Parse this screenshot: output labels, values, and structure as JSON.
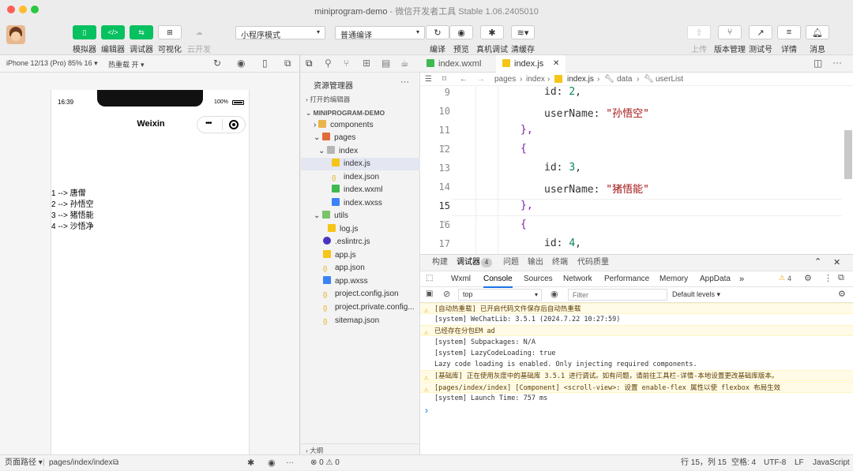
{
  "window": {
    "title": "miniprogram-demo",
    "subtitle": " - 微信开发者工具 Stable 1.06.2405010",
    "traffic_colors": [
      "#ff5f57",
      "#febc2e",
      "#28c840"
    ]
  },
  "toolbar": {
    "left_buttons": [
      {
        "label": "模拟器",
        "icon": "phone-icon"
      },
      {
        "label": "编辑器",
        "icon": "code-icon"
      },
      {
        "label": "调试器",
        "icon": "debug-icon"
      },
      {
        "label": "可视化",
        "icon": "layout-icon"
      },
      {
        "label": "云开发",
        "icon": "cloud-icon"
      }
    ],
    "mode_select": "小程序模式",
    "compile_select": "普通编译",
    "mid_buttons": [
      {
        "label": "编译",
        "icon": "refresh-icon"
      },
      {
        "label": "预览",
        "icon": "eye-icon"
      },
      {
        "label": "真机调试",
        "icon": "bug-icon"
      },
      {
        "label": "清缓存",
        "icon": "layers-icon"
      }
    ],
    "right_buttons": [
      {
        "label": "上传",
        "icon": "upload-icon"
      },
      {
        "label": "版本管理",
        "icon": "branch-icon"
      },
      {
        "label": "测试号",
        "icon": "external-link-icon"
      },
      {
        "label": "详情",
        "icon": "menu-icon"
      },
      {
        "label": "消息",
        "icon": "bell-icon"
      }
    ]
  },
  "simulator": {
    "device": "iPhone 12/13 (Pro) 85% 16 ▾",
    "hot_reload": "热重载 开 ▾",
    "time": "16:39",
    "battery": "100%",
    "nav_title": "Weixin",
    "capsule_dots": "•••",
    "list": [
      "1 --> 唐僧",
      "2 --> 孙悟空",
      "3 --> 猪悟能",
      "4 --> 沙悟净"
    ]
  },
  "explorer": {
    "title": "资源管理器",
    "more": "···",
    "open_editors": "打开的编辑器",
    "project": "MINIPROGRAM-DEMO",
    "outline": "大纲",
    "items": [
      {
        "name": "components",
        "type": "folder"
      },
      {
        "name": "pages",
        "type": "folder"
      },
      {
        "name": "index",
        "type": "folder"
      },
      {
        "name": "index.js",
        "type": "js"
      },
      {
        "name": "index.json",
        "type": "json"
      },
      {
        "name": "index.wxml",
        "type": "wxml"
      },
      {
        "name": "index.wxss",
        "type": "wxss"
      },
      {
        "name": "utils",
        "type": "folder"
      },
      {
        "name": "log.js",
        "type": "js"
      },
      {
        "name": ".eslintrc.js",
        "type": "eslint"
      },
      {
        "name": "app.js",
        "type": "js"
      },
      {
        "name": "app.json",
        "type": "json"
      },
      {
        "name": "app.wxss",
        "type": "wxss"
      },
      {
        "name": "project.config.json",
        "type": "json"
      },
      {
        "name": "project.private.config...",
        "type": "json"
      },
      {
        "name": "sitemap.json",
        "type": "json"
      }
    ]
  },
  "editor": {
    "tabs": [
      {
        "label": "index.wxml",
        "active": false
      },
      {
        "label": "index.js",
        "active": true
      }
    ],
    "close": "✕",
    "breadcrumb": [
      "pages",
      "index",
      "index.js",
      "data",
      "userList"
    ],
    "lines": [
      {
        "n": "9",
        "indent": 3,
        "key": "id",
        "num": "2",
        "tail": ","
      },
      {
        "n": "10",
        "indent": 3,
        "key": "userName",
        "str": "\"孙悟空\"",
        "tail": ""
      },
      {
        "n": "11",
        "indent": 2,
        "text": "},"
      },
      {
        "n": "12",
        "indent": 2,
        "text": "{"
      },
      {
        "n": "13",
        "indent": 3,
        "key": "id",
        "num": "3",
        "tail": ","
      },
      {
        "n": "14",
        "indent": 3,
        "key": "userName",
        "str": "\"猪悟能\"",
        "tail": ""
      },
      {
        "n": "15",
        "indent": 2,
        "text": "},"
      },
      {
        "n": "16",
        "indent": 2,
        "text": "{"
      },
      {
        "n": "17",
        "indent": 3,
        "key": "id",
        "num": "4",
        "tail": ","
      }
    ]
  },
  "panel": {
    "tabs": [
      "构建",
      "调试器",
      "问题",
      "输出",
      "终端",
      "代码质量"
    ],
    "debugger_badge": "4",
    "devtools_tabs": [
      "Wxml",
      "Console",
      "Sources",
      "Network",
      "Performance",
      "Memory",
      "AppData"
    ],
    "more_tabs": "»",
    "warn_count": "4",
    "context": "top",
    "filter_placeholder": "Filter",
    "levels": "Default levels ▾",
    "logs": [
      {
        "text": "[自动热重载] 已开启代码文件保存后自动热重载",
        "warn": true
      },
      {
        "text": "[system] WeChatLib: 3.5.1 (2024.7.22 10:27:59)",
        "warn": false
      },
      {
        "text": "已经存在分包EM ad",
        "warn": true
      },
      {
        "text": "[system] Subpackages: N/A",
        "warn": false
      },
      {
        "text": "[system] LazyCodeLoading: true",
        "warn": false
      },
      {
        "text": "Lazy code loading is enabled. Only injecting required components.",
        "warn": false
      },
      {
        "text": "[基础库] 正在使用灰度中的基础库 3.5.1 进行调试。如有问题，请前往工具栏-详情-本地设置更改基础库版本。",
        "warn": true
      },
      {
        "text": "[pages/index/index] [Component] <scroll-view>: 设置 enable-flex 属性以使 flexbox 布局生效",
        "warn": true
      },
      {
        "text": "[system] Launch Time: 757 ms",
        "warn": false
      }
    ],
    "prompt": "›"
  },
  "status": {
    "page_path_label": "页面路径 ▾",
    "page_path": "pages/index/index",
    "problems": "⊗ 0 ⚠ 0",
    "cursor": "行 15，列 15",
    "spaces": "空格: 4",
    "encoding": "UTF-8",
    "eol": "LF",
    "language": "JavaScript"
  }
}
